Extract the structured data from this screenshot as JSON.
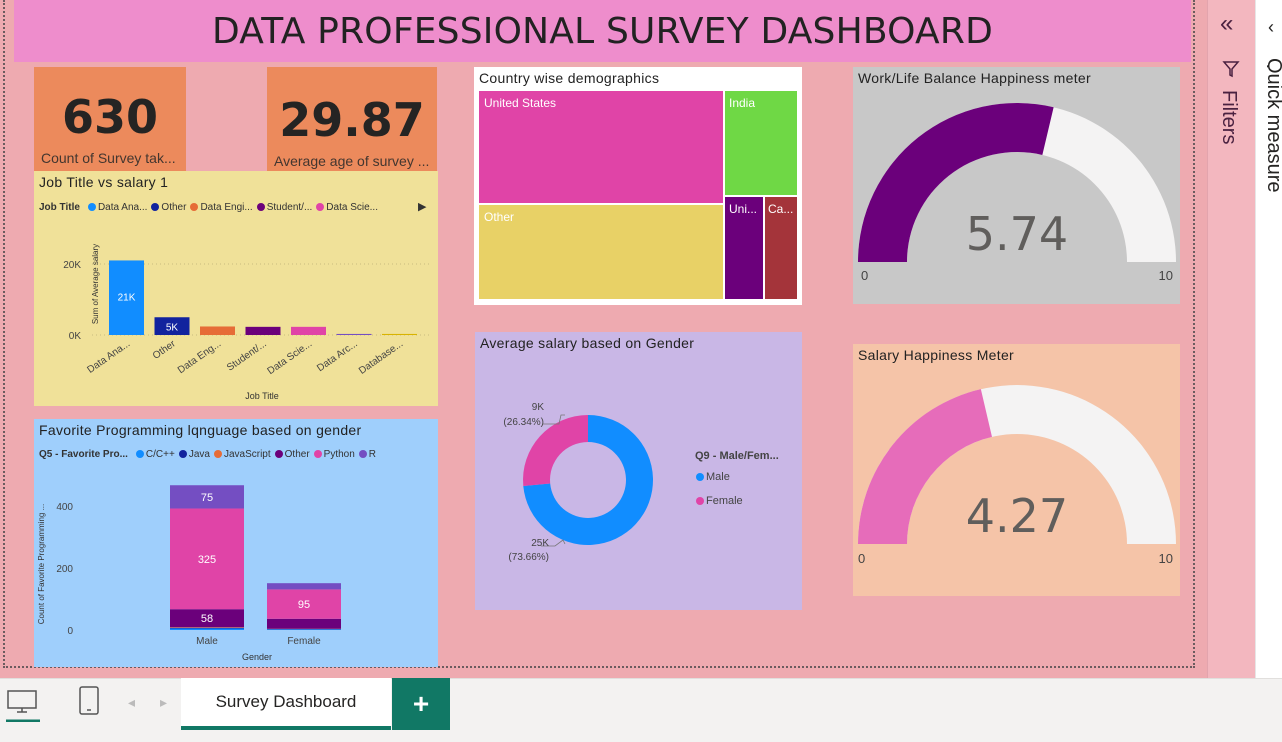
{
  "dashboard_title": "DATA PROFESSIONAL SURVEY DASHBOARD",
  "kpis": {
    "survey_count": {
      "value": "630",
      "label": "Count of Survey tak..."
    },
    "avg_age": {
      "value": "29.87",
      "label": "Average age of survey ..."
    }
  },
  "job_salary_chart": {
    "title": "Job Title vs salary 1",
    "legend_title": "Job Title",
    "legend": [
      {
        "name": "Data Ana...",
        "color": "#118dff"
      },
      {
        "name": "Other",
        "color": "#12239e"
      },
      {
        "name": "Data Engi...",
        "color": "#e66c37"
      },
      {
        "name": "Student/...",
        "color": "#6b007b"
      },
      {
        "name": "Data Scie...",
        "color": "#e044a7"
      }
    ],
    "ylabel": "Sum of Average salary",
    "xlabel": "Job Title",
    "yticks": [
      "20K",
      "0K"
    ]
  },
  "language_chart": {
    "title": "Favorite Programming lqnguage based on gender",
    "legend_title": "Q5 - Favorite Pro...",
    "legend": [
      {
        "name": "C/C++",
        "color": "#118dff"
      },
      {
        "name": "Java",
        "color": "#12239e"
      },
      {
        "name": "JavaScript",
        "color": "#e66c37"
      },
      {
        "name": "Other",
        "color": "#6b007b"
      },
      {
        "name": "Python",
        "color": "#e044a7"
      },
      {
        "name": "R",
        "color": "#744ec2"
      }
    ],
    "ylabel": "Count of Favorite Programming ...",
    "xlabel": "Gender",
    "yticks": [
      "400",
      "200",
      "0"
    ]
  },
  "treemap": {
    "title": "Country wise demographics",
    "items": [
      {
        "name": "United States",
        "color": "#e044a7"
      },
      {
        "name": "India",
        "color": "#6fd845"
      },
      {
        "name": "Other",
        "color": "#e8d166"
      },
      {
        "name": "Uni...",
        "color": "#6b007b"
      },
      {
        "name": "Ca...",
        "color": "#a4343a"
      }
    ]
  },
  "donut": {
    "title": "Average salary based on Gender",
    "legend_title": "Q9 - Male/Fem...",
    "labels": {
      "female_value": "9K",
      "female_pct": "(26.34%)",
      "male_value": "25K",
      "male_pct": "(73.66%)"
    },
    "legend": [
      {
        "name": "Male",
        "color": "#118dff"
      },
      {
        "name": "Female",
        "color": "#e044a7"
      }
    ]
  },
  "gauge_work": {
    "title": "Work/Life Balance Happiness meter",
    "value": "5.74",
    "min": "0",
    "max": "10",
    "fill_color": "#6b007b"
  },
  "gauge_salary": {
    "title": "Salary Happiness Meter",
    "value": "4.27",
    "min": "0",
    "max": "10",
    "fill_color": "#e66cba"
  },
  "side_panes": {
    "filters": "Filters",
    "quick_measure": "Quick measure"
  },
  "bottom": {
    "active_tab": "Survey Dashboard",
    "add_tab": "+"
  },
  "chart_data": [
    {
      "type": "bar",
      "title": "Job Title vs salary 1",
      "xlabel": "Job Title",
      "ylabel": "Sum of Average salary",
      "categories": [
        "Data Ana...",
        "Other",
        "Data Eng...",
        "Student/...",
        "Data Scie...",
        "Data Arc...",
        "Database..."
      ],
      "values": [
        21000,
        5000,
        2400,
        2300,
        2300,
        300,
        300
      ],
      "data_labels": [
        "21K",
        "5K",
        "",
        "",
        "",
        "",
        ""
      ],
      "colors": [
        "#118dff",
        "#12239e",
        "#e66c37",
        "#6b007b",
        "#e044a7",
        "#744ec2",
        "#d9b300"
      ],
      "ylim": [
        0,
        25000
      ],
      "grid": true
    },
    {
      "type": "bar",
      "stacked": true,
      "title": "Favorite Programming lqnguage based on gender",
      "xlabel": "Gender",
      "ylabel": "Count of Favorite Programming ...",
      "categories": [
        "Male",
        "Female"
      ],
      "series": [
        {
          "name": "C/C++",
          "values": [
            5,
            2
          ]
        },
        {
          "name": "Java",
          "values": [
            2,
            1
          ]
        },
        {
          "name": "JavaScript",
          "values": [
            2,
            1
          ]
        },
        {
          "name": "Other",
          "values": [
            58,
            32
          ]
        },
        {
          "name": "Python",
          "values": [
            325,
            95
          ]
        },
        {
          "name": "R",
          "values": [
            75,
            20
          ]
        }
      ],
      "series_colors": [
        "#118dff",
        "#12239e",
        "#e66c37",
        "#6b007b",
        "#e044a7",
        "#744ec2"
      ],
      "ylim": [
        0,
        480
      ]
    },
    {
      "type": "pie",
      "donut": true,
      "title": "Average salary based on Gender",
      "categories": [
        "Male",
        "Female"
      ],
      "values": [
        25000,
        9000
      ],
      "percentages": [
        73.66,
        26.34
      ]
    },
    {
      "type": "gauge",
      "title": "Work/Life Balance Happiness meter",
      "value": 5.74,
      "range": [
        0,
        10
      ]
    },
    {
      "type": "gauge",
      "title": "Salary Happiness Meter",
      "value": 4.27,
      "range": [
        0,
        10
      ]
    }
  ]
}
